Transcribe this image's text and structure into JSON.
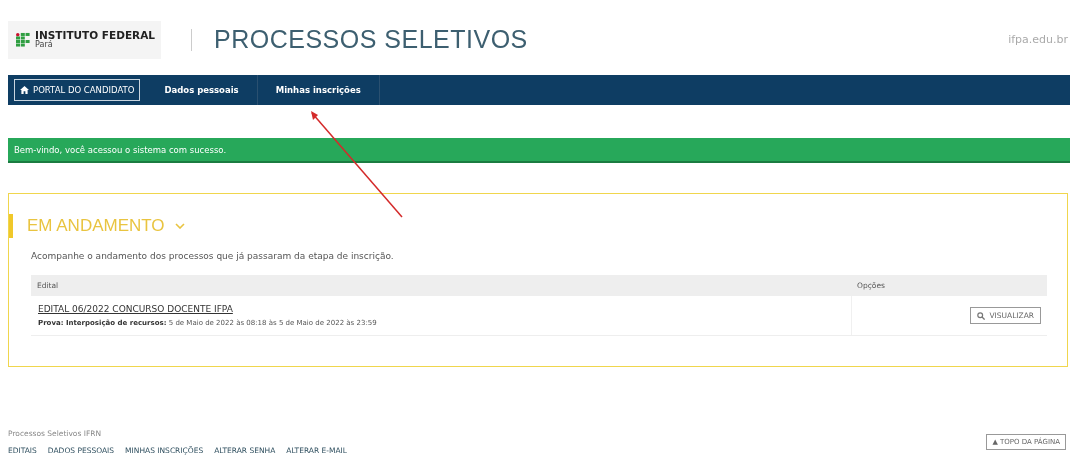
{
  "header": {
    "logo_title": "INSTITUTO FEDERAL",
    "logo_subtitle": "Pará",
    "title": "PROCESSOS SELETIVOS",
    "site": "ifpa.edu.br"
  },
  "nav": [
    {
      "label": "PORTAL DO CANDIDATO",
      "kind": "home",
      "selected": true
    },
    {
      "label": "Dados pessoais",
      "kind": "link",
      "selected": false
    },
    {
      "label": "Minhas inscrições",
      "kind": "link",
      "selected": false
    }
  ],
  "alert": "Bem-vindo, você acessou o sistema com sucesso.",
  "section": {
    "title": "EM ANDAMENTO",
    "expanded": true,
    "description": "Acompanhe o andamento dos processos que já passaram da etapa de inscrição.",
    "table": {
      "columns": [
        "Edital",
        "Opções"
      ],
      "rows": [
        {
          "title": "EDITAL 06/2022 CONCURSO DOCENTE IFPA",
          "detail": "**Prova: Interposição de recursos:** 5 de Maio de 2022 às 08:18 às 5 de Maio de 2022 às 23:59",
          "button": "VISUALIZAR"
        }
      ]
    }
  },
  "footer": {
    "title": "Processos Seletivos IFRN",
    "links": [
      "EDITAIS",
      "DADOS PESSOAIS",
      "MINHAS INSCRIÇÕES",
      "ALTERAR SENHA",
      "ALTERAR E-MAIL"
    ],
    "top_button": "▲ TOPO DA PÁGINA"
  }
}
